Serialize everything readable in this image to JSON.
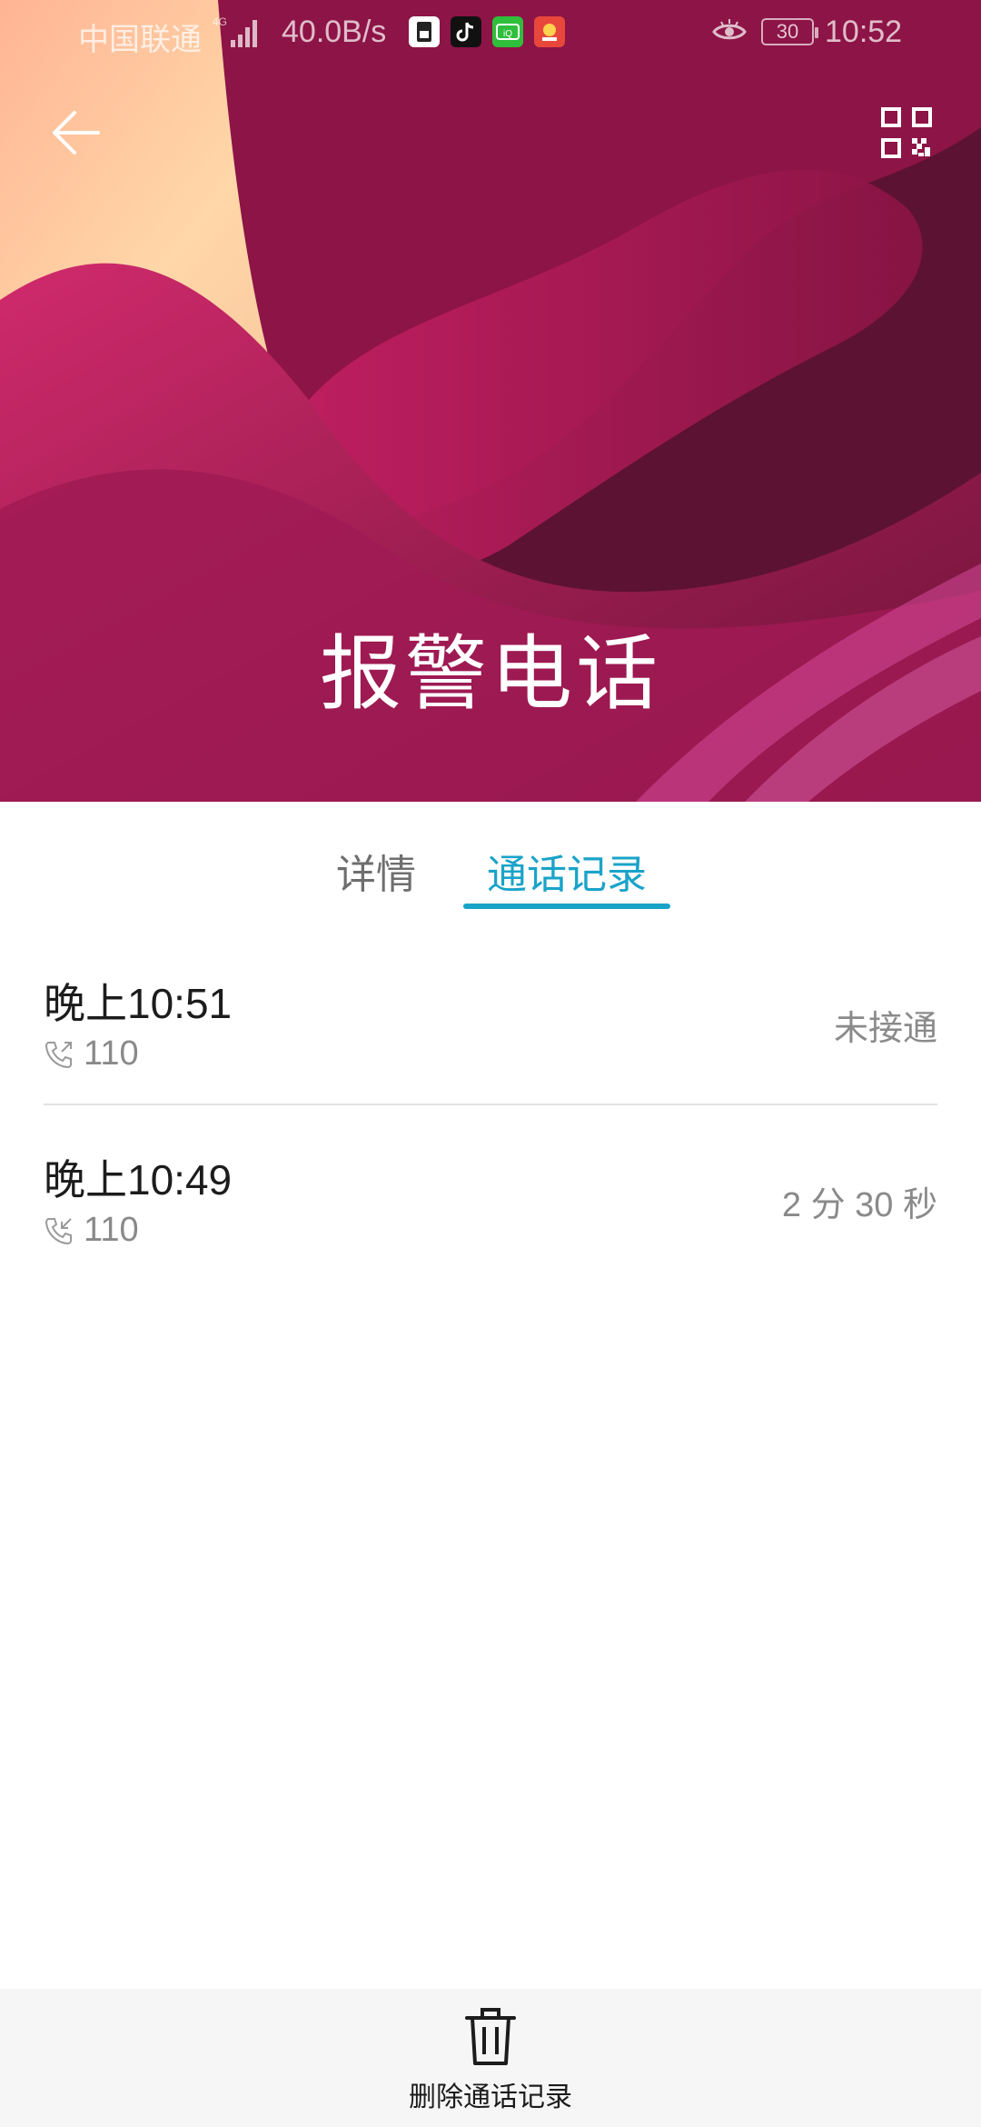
{
  "status_bar": {
    "carrier": "中国联通",
    "network": "4G",
    "speed": "40.0B/s",
    "battery": "30",
    "time": "10:52",
    "app_icons": [
      "sim-manager-icon",
      "tiktok-icon",
      "iqiyi-icon",
      "game-icon"
    ]
  },
  "header": {
    "contact_name": "报警电话",
    "back_icon": "arrow-left-icon",
    "qr_icon": "qr-code-icon"
  },
  "tabs": [
    {
      "label": "详情",
      "active": false
    },
    {
      "label": "通话记录",
      "active": true
    }
  ],
  "calls": [
    {
      "time": "晚上10:51",
      "direction": "outgoing",
      "icon": "outgoing-call-icon",
      "number": "110",
      "status": "未接通"
    },
    {
      "time": "晚上10:49",
      "direction": "incoming",
      "icon": "incoming-call-icon",
      "number": "110",
      "status": "2 分 30 秒"
    }
  ],
  "bottom_bar": {
    "delete_label": "删除通话记录",
    "delete_icon": "trash-icon"
  },
  "colors": {
    "accent": "#1aa3c9",
    "header_primary": "#c21d5f",
    "header_dark": "#4e0f2b"
  }
}
